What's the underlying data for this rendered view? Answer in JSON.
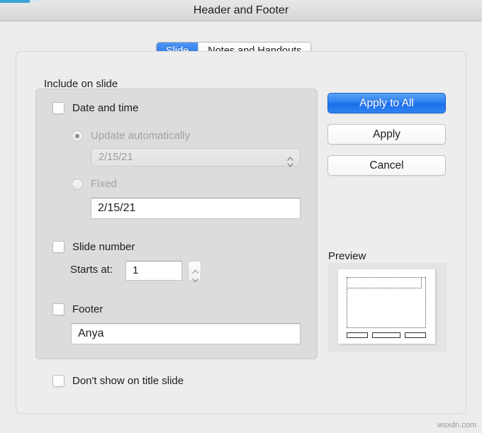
{
  "window": {
    "title": "Header and Footer"
  },
  "tabs": [
    {
      "id": "slide",
      "label": "Slide",
      "active": true
    },
    {
      "id": "notes",
      "label": "Notes and Handouts",
      "active": false
    }
  ],
  "include_section": {
    "label": "Include on slide",
    "date_and_time": {
      "checkbox_label": "Date and time",
      "checked": false,
      "update_automatically": {
        "label": "Update automatically",
        "selected": true,
        "enabled": false,
        "date_value": "2/15/21"
      },
      "fixed": {
        "label": "Fixed",
        "selected": false,
        "enabled": false,
        "value": "2/15/21"
      }
    },
    "slide_number": {
      "checkbox_label": "Slide number",
      "checked": false,
      "starts_at_label": "Starts at:",
      "starts_at_value": "1"
    },
    "footer": {
      "checkbox_label": "Footer",
      "checked": false,
      "value": "Anya"
    }
  },
  "dont_show_on_title_slide": {
    "label": "Don't show on title slide",
    "checked": false
  },
  "buttons": {
    "apply_to_all": "Apply to All",
    "apply": "Apply",
    "cancel": "Cancel"
  },
  "preview": {
    "label": "Preview"
  },
  "watermark": "wsxdn.com",
  "colors": {
    "accent_blue": "#2a7ef0",
    "tab_active_blue": "#2f83f2",
    "window_bg": "#ececec",
    "group_bg": "#dcdcdc",
    "titlebar_accent": "#3aa3d4"
  }
}
